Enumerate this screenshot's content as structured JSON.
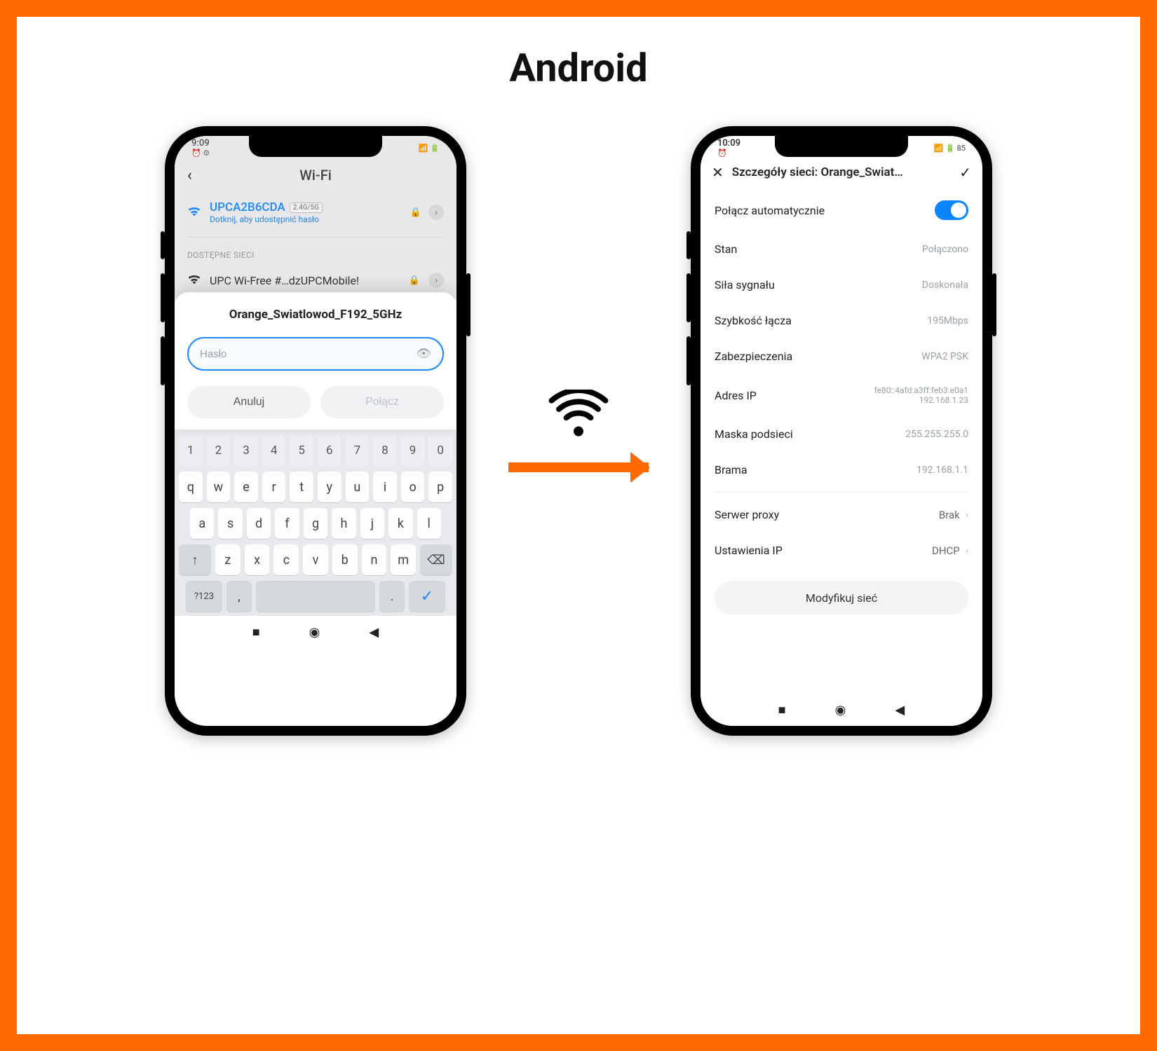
{
  "title": "Android",
  "phone1": {
    "status_time": "9:09",
    "status_icons": "⏰ ⚙︎",
    "status_right": "📶 🔋",
    "header": "Wi-Fi",
    "connected": {
      "ssid": "UPCA2B6CDA",
      "badge": "2.4G/5G",
      "sub": "Dotknij, aby udostępnić hasło"
    },
    "section_label": "DOSTĘPNE SIECI",
    "available_row": "UPC Wi-Free #…dzUPCMobile!",
    "dialog": {
      "title": "Orange_Swiatlowod_F192_5GHz",
      "placeholder": "Hasło",
      "cancel": "Anuluj",
      "connect": "Połącz"
    },
    "keyboard": {
      "row_num": [
        "1",
        "2",
        "3",
        "4",
        "5",
        "6",
        "7",
        "8",
        "9",
        "0"
      ],
      "row_q": [
        "q",
        "w",
        "e",
        "r",
        "t",
        "y",
        "u",
        "i",
        "o",
        "p"
      ],
      "row_a": [
        "a",
        "s",
        "d",
        "f",
        "g",
        "h",
        "j",
        "k",
        "l"
      ],
      "row_z": [
        "z",
        "x",
        "c",
        "v",
        "b",
        "n",
        "m"
      ],
      "shift": "↑",
      "backspace": "⌫",
      "sym": "?123",
      "comma": ",",
      "period": ".",
      "enter": "✓"
    },
    "nav": {
      "recent": "■",
      "home": "◉",
      "back": "◀"
    }
  },
  "phone2": {
    "status_time": "10:09",
    "status_icons": "⏰",
    "status_right": "📶 🔋 85",
    "header": "Szczegóły sieci: Orange_Swiat…",
    "rows": {
      "auto_connect_label": "Połącz automatycznie",
      "stan": {
        "label": "Stan",
        "value": "Połączono"
      },
      "sila": {
        "label": "Siła sygnału",
        "value": "Doskonała"
      },
      "szyb": {
        "label": "Szybkość łącza",
        "value": "195Mbps"
      },
      "zab": {
        "label": "Zabezpieczenia",
        "value": "WPA2 PSK"
      },
      "ip": {
        "label": "Adres IP",
        "value": "fe80::4afd:a3ff:feb3:e0a1\n192.168.1.23"
      },
      "mask": {
        "label": "Maska podsieci",
        "value": "255.255.255.0"
      },
      "brama": {
        "label": "Brama",
        "value": "192.168.1.1"
      },
      "proxy": {
        "label": "Serwer proxy",
        "value": "Brak"
      },
      "ipset": {
        "label": "Ustawienia IP",
        "value": "DHCP"
      }
    },
    "modify": "Modyfikuj sieć",
    "nav": {
      "recent": "■",
      "home": "◉",
      "back": "◀"
    }
  }
}
